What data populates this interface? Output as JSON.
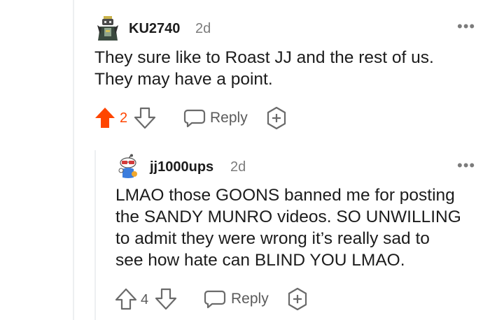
{
  "comment1": {
    "username": "KU2740",
    "time": "2d",
    "more_icon": "•••",
    "lines": [
      "They sure like to Roast JJ and the rest of us.",
      "They may have a point."
    ],
    "vote_count": "2",
    "reply_label": "Reply",
    "upvote_color": "#ff4500"
  },
  "comment2": {
    "username": "jj1000ups",
    "time": "2d",
    "more_icon": "•••",
    "lines": [
      "LMAO those GOONS banned me for posting",
      "the SANDY MUNRO videos. SO UNWILLING",
      "to admit they were wrong it’s really sad to",
      "see how hate can BLIND YOU LMAO."
    ],
    "vote_count": "4",
    "reply_label": "Reply"
  }
}
